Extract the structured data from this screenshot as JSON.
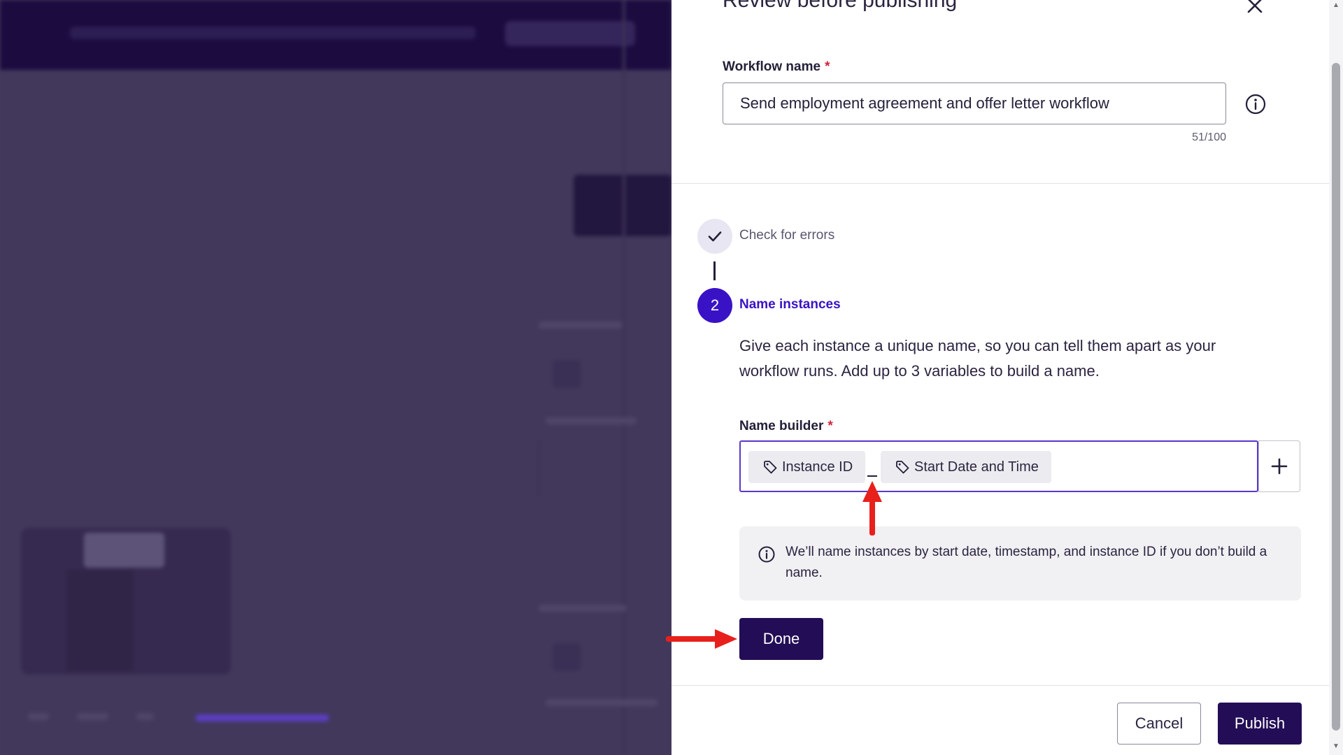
{
  "modal": {
    "title": "Review before publishing",
    "workflow_name": {
      "label": "Workflow name",
      "required_mark": "*",
      "value": "Send employment agreement and offer letter workflow",
      "counter": "51/100"
    },
    "steps": [
      {
        "number": "✓",
        "label": "Check for errors",
        "state": "complete"
      },
      {
        "number": "2",
        "label": "Name instances",
        "state": "active"
      }
    ],
    "name_instances": {
      "description": "Give each instance a unique name, so you can tell them apart as your workflow runs. Add up to 3 variables to build a name.",
      "builder_label": "Name builder",
      "required_mark": "*",
      "chips": [
        "Instance ID",
        "Start Date and Time"
      ],
      "info_text": "We’ll name instances by start date, timestamp, and instance ID if you don’t build a name.",
      "done_label": "Done"
    },
    "footer": {
      "cancel_label": "Cancel",
      "publish_label": "Publish"
    }
  },
  "icons": {
    "close": "close-icon",
    "info": "info-icon",
    "check": "check-icon",
    "tag": "tag-icon",
    "plus": "plus-icon"
  },
  "colors": {
    "accent": "#3a12c6",
    "primary_button": "#230d56",
    "required": "#d0243a",
    "annotation_arrow": "#e8201c",
    "overlay": "#42385c"
  }
}
